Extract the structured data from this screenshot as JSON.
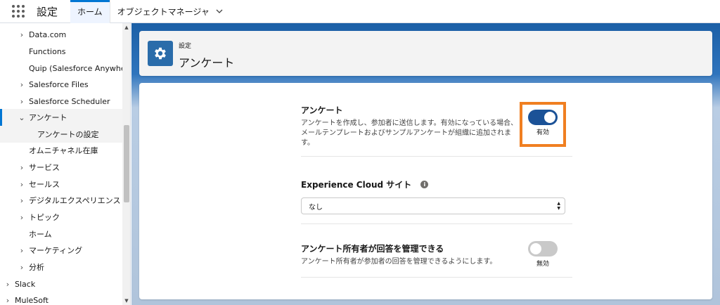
{
  "topbar": {
    "app_name": "設定",
    "tabs": [
      {
        "label": "ホーム"
      },
      {
        "label": "オブジェクトマネージャ"
      }
    ]
  },
  "sidebar": {
    "items": [
      {
        "label": "Data.com",
        "expandable": true,
        "state": "collapsed"
      },
      {
        "label": "Functions",
        "expandable": false
      },
      {
        "label": "Quip (Salesforce Anywhere)",
        "expandable": false
      },
      {
        "label": "Salesforce Files",
        "expandable": true,
        "state": "collapsed"
      },
      {
        "label": "Salesforce Scheduler",
        "expandable": true,
        "state": "collapsed"
      },
      {
        "label": "アンケート",
        "expandable": true,
        "state": "expanded"
      },
      {
        "label": "アンケートの設定",
        "expandable": false
      },
      {
        "label": "オムニチャネル在庫",
        "expandable": false
      },
      {
        "label": "サービス",
        "expandable": true,
        "state": "collapsed"
      },
      {
        "label": "セールス",
        "expandable": true,
        "state": "collapsed"
      },
      {
        "label": "デジタルエクスペリエンス",
        "expandable": true,
        "state": "collapsed"
      },
      {
        "label": "トピック",
        "expandable": true,
        "state": "collapsed"
      },
      {
        "label": "ホーム",
        "expandable": false
      },
      {
        "label": "マーケティング",
        "expandable": true,
        "state": "collapsed"
      },
      {
        "label": "分析",
        "expandable": true,
        "state": "collapsed"
      },
      {
        "label": "Slack",
        "expandable": true,
        "state": "collapsed"
      },
      {
        "label": "MuleSoft",
        "expandable": true,
        "state": "collapsed"
      }
    ]
  },
  "header": {
    "eyebrow": "設定",
    "title": "アンケート",
    "icon": "gear-icon"
  },
  "settings": {
    "surveys": {
      "title": "アンケート",
      "description": "アンケートを作成し、参加者に送信します。有効になっている場合、メールテンプレートおよびサンプルアンケートが組織に追加されます。",
      "toggle_label": "有効",
      "enabled": true
    },
    "experience_cloud": {
      "title": "Experience Cloud サイト",
      "info": "i",
      "selected": "なし"
    },
    "owner_manage": {
      "title": "アンケート所有者が回答を管理できる",
      "description": "アンケート所有者が参加者の回答を管理できるようにします。",
      "toggle_label": "無効",
      "enabled": false
    }
  },
  "colors": {
    "accent": "#0176d3",
    "toggle_on": "#1b5297",
    "highlight": "#f07f21",
    "header_icon_bg": "#2a6caa"
  }
}
